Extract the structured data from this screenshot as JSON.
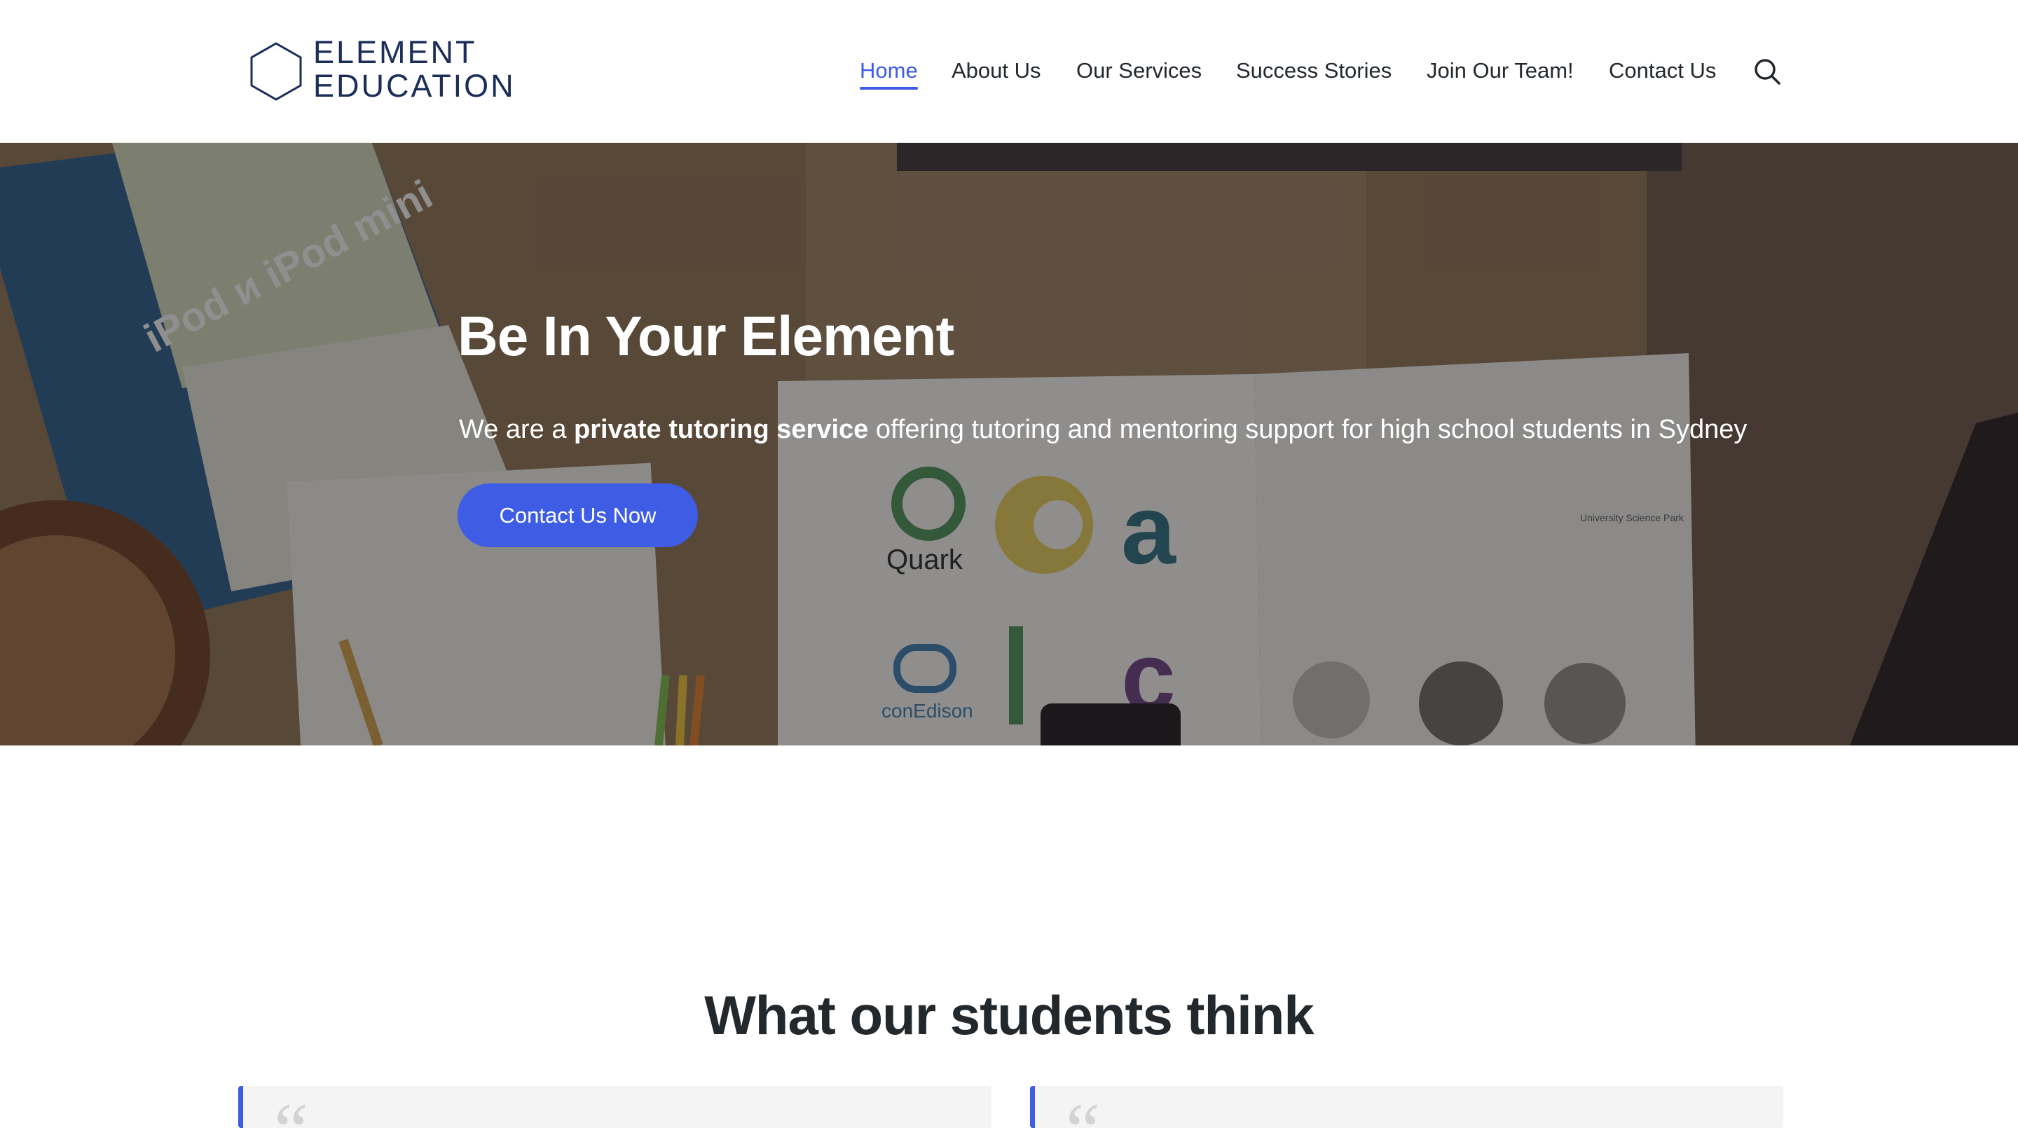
{
  "site": {
    "logo_line1": "ELEMENT",
    "logo_line2": "EDUCATION",
    "brand_color": "#1b2d59",
    "accent_color": "#3f5ce5"
  },
  "nav": {
    "items": [
      {
        "label": "Home",
        "active": true
      },
      {
        "label": "About Us",
        "active": false
      },
      {
        "label": "Our Services",
        "active": false
      },
      {
        "label": "Success Stories",
        "active": false
      },
      {
        "label": "Join Our Team!",
        "active": false
      },
      {
        "label": "Contact Us",
        "active": false
      }
    ],
    "search_icon": "search-icon"
  },
  "hero": {
    "title": "Be In Your Element",
    "subtitle_prefix": "We are a ",
    "subtitle_bold": "private tutoring service",
    "subtitle_suffix": " offering tutoring and mentoring support for high school students in Sydney",
    "button_label": "Contact Us Now",
    "background": "desk-photo-image",
    "background_text": {
      "magazine": "iPod и iPod mini",
      "logo_quark": "Quark",
      "logo_conedison": "conEdison",
      "logo_university": "University Science Park"
    }
  },
  "testimonials": {
    "title": "What our students think",
    "quote_glyph": "“"
  }
}
